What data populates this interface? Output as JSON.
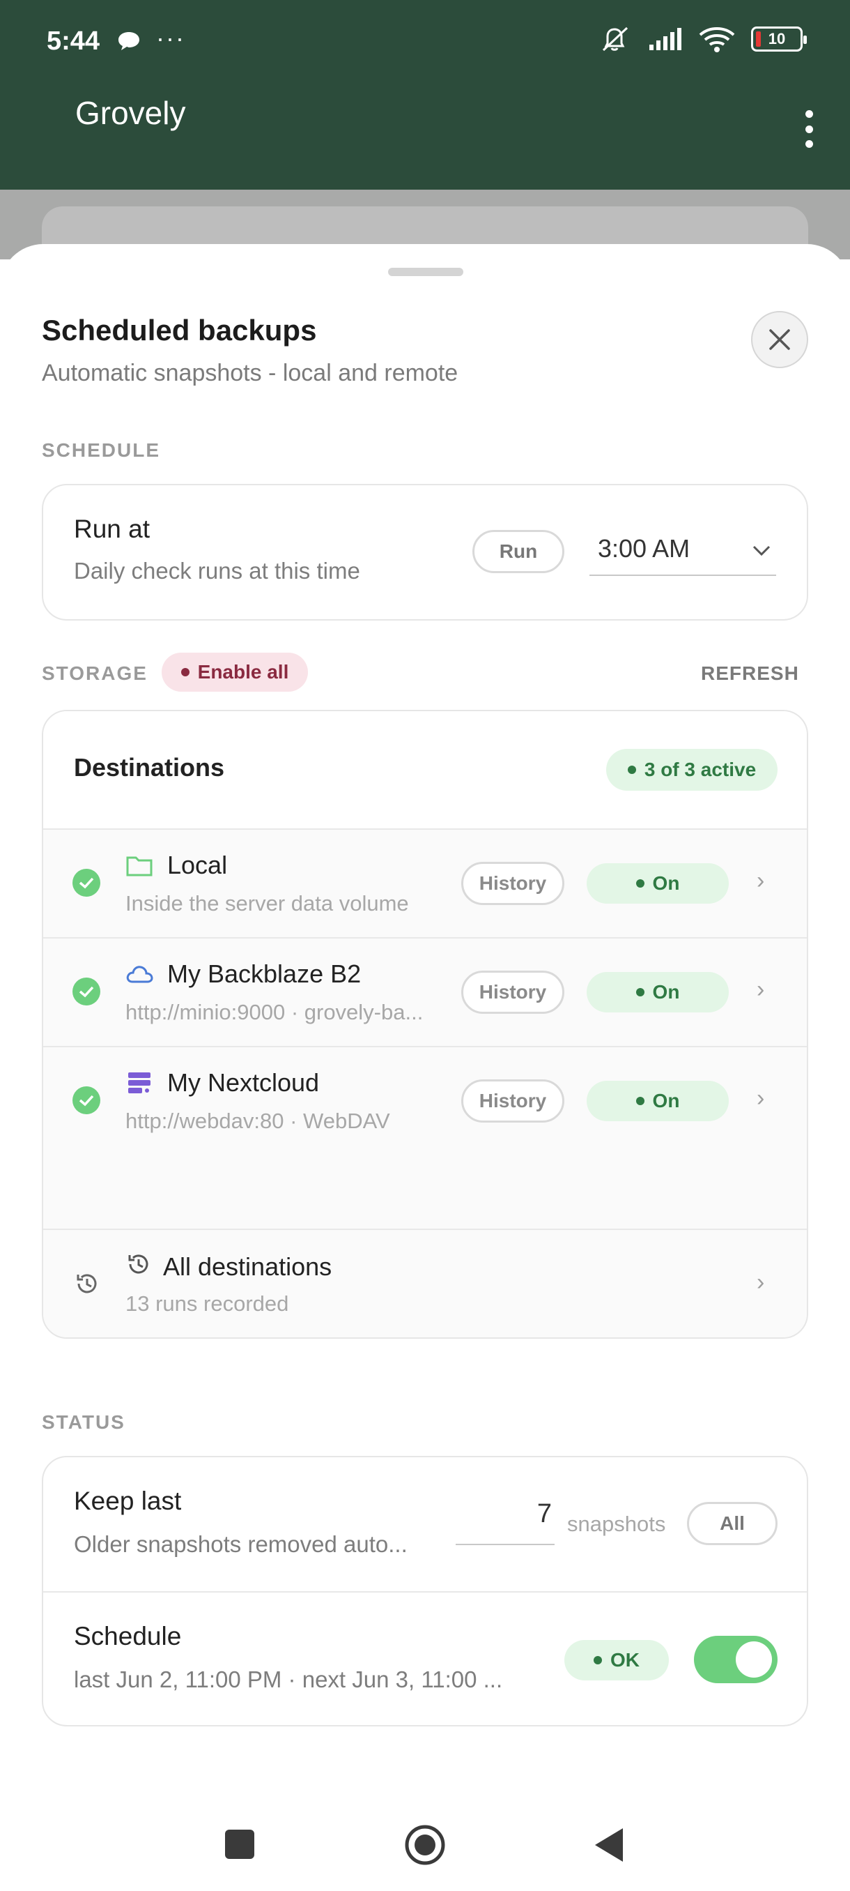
{
  "status_bar": {
    "time": "5:44",
    "dots": "···",
    "battery": "10",
    "icons": [
      "chat-bubble-icon",
      "mute-icon",
      "signal-icon",
      "wifi-icon",
      "battery-icon"
    ]
  },
  "app_bar": {
    "title": "Grovely"
  },
  "sheet": {
    "title": "Scheduled backups",
    "subtitle": "Automatic snapshots - local and remote"
  },
  "schedule": {
    "section_label": "SCHEDULE",
    "title": "Run at",
    "subtitle": "Daily check runs at this time",
    "run_label": "Run",
    "time_value": "3:00 AM"
  },
  "storage": {
    "section_label": "STORAGE",
    "enable_all_label": "Enable all",
    "refresh_label": "REFRESH",
    "destinations_title": "Destinations",
    "active_badge": "3 of 3 active",
    "destinations": [
      {
        "name": "Local",
        "detail": "Inside the server data volume",
        "history_label": "History",
        "state_label": "On",
        "icon": "folder-icon"
      },
      {
        "name": "My Backblaze B2",
        "detail": "http://minio:9000 · grovely-ba...",
        "history_label": "History",
        "state_label": "On",
        "icon": "cloud-icon"
      },
      {
        "name": "My Nextcloud",
        "detail": "http://webdav:80 · WebDAV",
        "history_label": "History",
        "state_label": "On",
        "icon": "server-icon"
      }
    ],
    "all_destinations": {
      "title": "All destinations",
      "subtitle": "13 runs recorded"
    }
  },
  "status": {
    "section_label": "STATUS",
    "keep_last": {
      "title": "Keep last",
      "subtitle": "Older snapshots removed auto...",
      "count": "7",
      "unit": "snapshots",
      "all_label": "All"
    },
    "schedule_row": {
      "title": "Schedule",
      "subtitle": "last Jun 2, 11:00 PM · next Jun 3, 11:00 ...",
      "badge": "OK",
      "enabled": true
    }
  },
  "colors": {
    "app_bar": "#2c4c3b",
    "accent_green": "#6ccf7d",
    "badge_green_bg": "#e3f6e6",
    "badge_green_text": "#2f7a43",
    "enable_all_bg": "#f9e3e8",
    "enable_all_text": "#8a2a40"
  }
}
